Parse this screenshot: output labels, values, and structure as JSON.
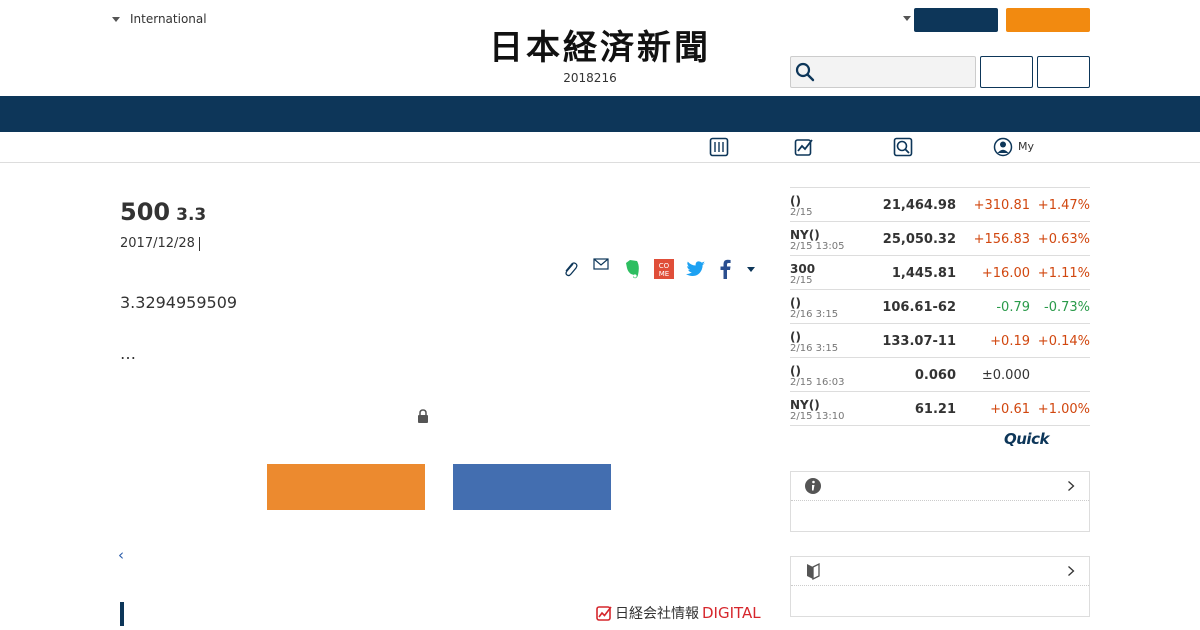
{
  "header": {
    "edition_label": "International",
    "logo_text": "日本経済新聞",
    "date": "2018216",
    "search_placeholder": ""
  },
  "subnav": {
    "my_label": "My"
  },
  "article": {
    "title_main": "500",
    "title_sub": "3.3",
    "date": "2017/12/28",
    "body": "3.3294959509",
    "ellipsis": "…",
    "back_link": "‹",
    "footer_brand_prefix": "日経会社情報",
    "footer_brand_suffix": "DIGITAL"
  },
  "market": {
    "rows": [
      {
        "name": "()",
        "time": "2/15",
        "value": "21,464.98",
        "change": "+310.81",
        "percent": "+1.47%",
        "dir": "up"
      },
      {
        "name": "NY()",
        "time": "2/15 13:05",
        "value": "25,050.32",
        "change": "+156.83",
        "percent": "+0.63%",
        "dir": "up"
      },
      {
        "name": "300",
        "time": "2/15",
        "value": "1,445.81",
        "change": "+16.00",
        "percent": "+1.11%",
        "dir": "up"
      },
      {
        "name": "()",
        "time": "2/16 3:15",
        "value": "106.61-62",
        "change": "-0.79",
        "percent": "-0.73%",
        "dir": "down"
      },
      {
        "name": "()",
        "time": "2/16 3:15",
        "value": "133.07-11",
        "change": "+0.19",
        "percent": "+0.14%",
        "dir": "up"
      },
      {
        "name": "()",
        "time": "2/15 16:03",
        "value": "0.060",
        "change": "±0.000",
        "percent": "",
        "dir": "flat"
      },
      {
        "name": "NY()",
        "time": "2/15 13:10",
        "value": "61.21",
        "change": "+0.61",
        "percent": "+1.00%",
        "dir": "up"
      }
    ],
    "provider": "Quick"
  },
  "colors": {
    "navy": "#0d3659",
    "orange": "#f28a10",
    "cta_orange": "#ec8a2f",
    "cta_blue": "#436eb0",
    "up": "#d1470f",
    "down": "#2a9a4a"
  },
  "icons": {
    "search": "search-icon",
    "portfolio": "portfolio-icon",
    "chart": "chart-icon",
    "screening": "screening-icon",
    "user": "user-icon",
    "clip": "clip-icon",
    "mail": "mail-icon",
    "evernote": "evernote-icon",
    "come": "come-icon",
    "twitter": "twitter-icon",
    "facebook": "facebook-icon",
    "lock": "lock-icon",
    "info": "info-icon",
    "beginner": "beginner-icon"
  }
}
